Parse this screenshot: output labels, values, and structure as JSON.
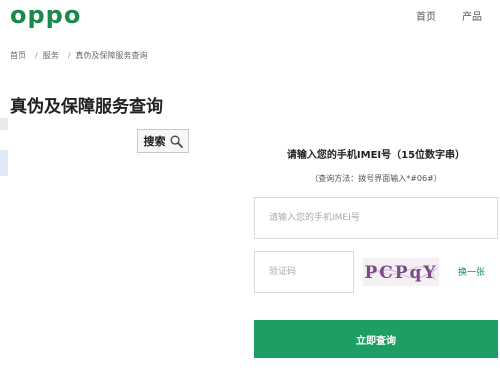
{
  "header": {
    "logo": "oppo",
    "nav": [
      "首页",
      "产品"
    ]
  },
  "breadcrumb": [
    "首页",
    "服务",
    "真伪及保障服务查询"
  ],
  "page_title": "真伪及保障服务查询",
  "search_button": {
    "label": "搜索",
    "icon": "search-icon"
  },
  "form": {
    "prompt": "请输入您的手机IMEI号（15位数字串）",
    "hint": "（查询方法：拨号界面输入*#06#）",
    "imei_placeholder": "请输入您的手机IMEI号",
    "code_placeholder": "验证码",
    "captcha_text": "PCPqY",
    "refresh_label": "换一张",
    "submit_label": "立即查询"
  },
  "colors": {
    "brand": "#1a8a4a",
    "button": "#1d9f63"
  }
}
